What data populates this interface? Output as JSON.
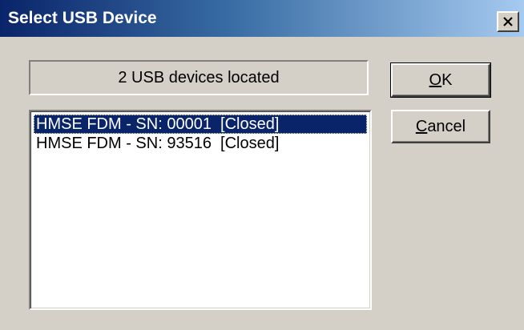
{
  "window": {
    "title": "Select USB Device",
    "close_icon": "close-icon"
  },
  "status": {
    "text": "2 USB devices located"
  },
  "devices": [
    {
      "label": "HMSE FDM - SN: 00001  [Closed]",
      "selected": true
    },
    {
      "label": "HMSE FDM - SN: 93516  [Closed]",
      "selected": false
    }
  ],
  "buttons": {
    "ok": {
      "mnemonic": "O",
      "rest": "K"
    },
    "cancel": {
      "mnemonic": "C",
      "rest": "ancel"
    }
  },
  "colors": {
    "face": "#d4d0c8",
    "title_start": "#0a246a",
    "title_end": "#a6caf0",
    "selection": "#0a246a"
  }
}
